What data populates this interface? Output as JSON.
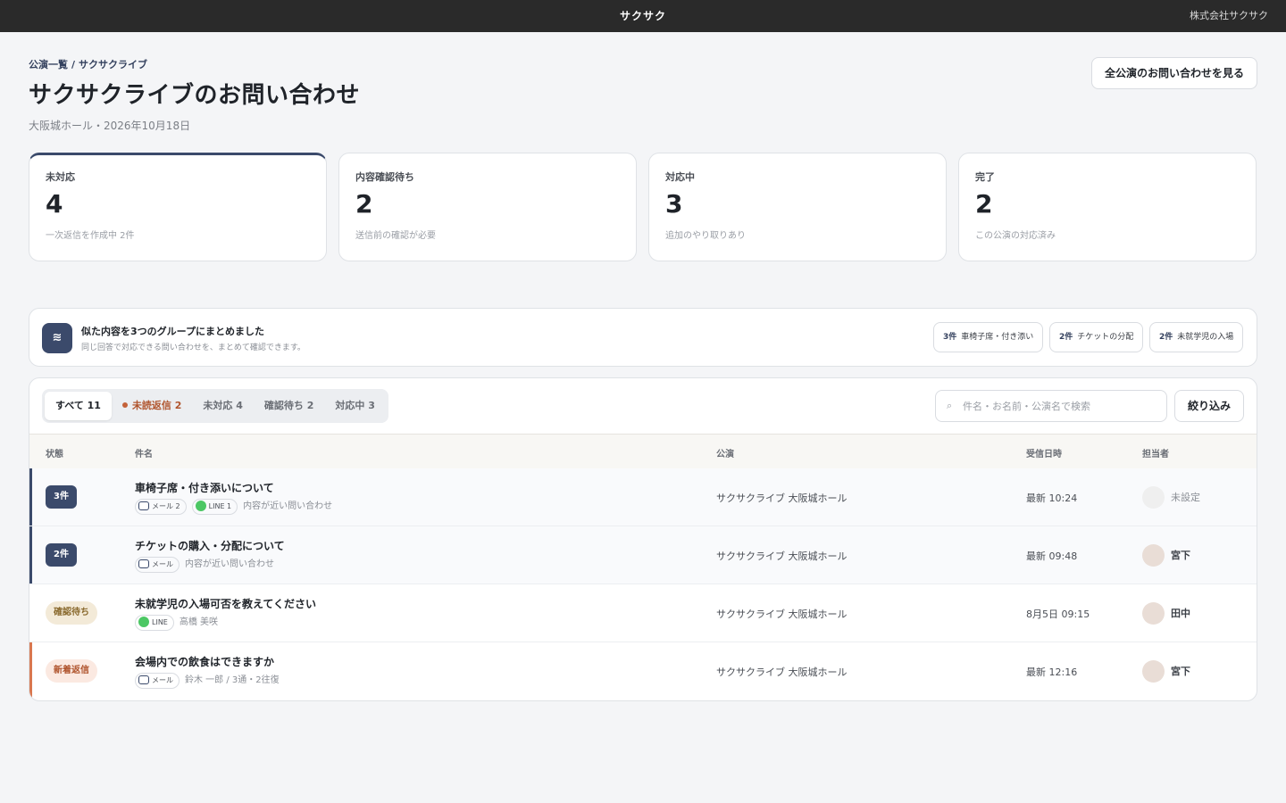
{
  "topbar": {
    "brand": "サクサク",
    "company": "株式会社サクサク"
  },
  "breadcrumb": {
    "root": "公演一覧",
    "sep": "/",
    "current": "サクサクライブ"
  },
  "page": {
    "title": "サクサクライブのお問い合わせ",
    "subtitle": "大阪城ホール・2026年10月18日",
    "all_button": "全公演のお問い合わせを見る"
  },
  "stats": [
    {
      "label": "未対応",
      "value": "4",
      "note": "一次返信を作成中 2件"
    },
    {
      "label": "内容確認待ち",
      "value": "2",
      "note": "送信前の確認が必要"
    },
    {
      "label": "対応中",
      "value": "3",
      "note": "追加のやり取りあり"
    },
    {
      "label": "完了",
      "value": "2",
      "note": "この公演の対応済み"
    }
  ],
  "groups": {
    "icon": "≋",
    "title": "似た内容を3つのグループにまとめました",
    "subtitle": "同じ回答で対応できる問い合わせを、まとめて確認できます。",
    "chips": [
      {
        "count": "3件",
        "label": "車椅子席・付き添い"
      },
      {
        "count": "2件",
        "label": "チケットの分配"
      },
      {
        "count": "2件",
        "label": "未就学児の入場"
      }
    ]
  },
  "tabs": [
    {
      "label": "すべて 11"
    },
    {
      "label": "未読返信 2"
    },
    {
      "label": "未対応 4"
    },
    {
      "label": "確認待ち 2"
    },
    {
      "label": "対応中 3"
    }
  ],
  "search": {
    "icon": "search-icon",
    "placeholder": "件名・お名前・公演名で検索"
  },
  "filter_button": "絞り込み",
  "columns": {
    "status": "状態",
    "subject": "件名",
    "performance": "公演",
    "received": "受信日時",
    "owner": "担当者"
  },
  "colors": {
    "navy": "#3b4a6b",
    "confirm_bg": "#f3ead8",
    "confirm_fg": "#8a6a2e",
    "new_bg": "#fbe9e1",
    "new_fg": "#b0552e",
    "new_accent": "#d9774f",
    "line_green": "#4cc764",
    "avatar": "#e9ddd6",
    "avatar_unset": "#efefef"
  },
  "rows": [
    {
      "status": "3件",
      "subject": "車椅子席・付き添いについて",
      "tags": [
        "メール 2",
        "LINE 1"
      ],
      "meta": "内容が近い問い合わせ",
      "performance": "サクサクライブ 大阪城ホール",
      "received": "最新 10:24",
      "owner": "未設定"
    },
    {
      "status": "2件",
      "subject": "チケットの購入・分配について",
      "tags": [
        "メール"
      ],
      "meta": "内容が近い問い合わせ",
      "performance": "サクサクライブ 大阪城ホール",
      "received": "最新 09:48",
      "owner": "宮下"
    },
    {
      "status": "確認待ち",
      "subject": "未就学児の入場可否を教えてください",
      "tags": [
        "LINE"
      ],
      "meta": "高橋 美咲",
      "performance": "サクサクライブ 大阪城ホール",
      "received": "8月5日 09:15",
      "owner": "田中"
    },
    {
      "status": "新着返信",
      "subject": "会場内での飲食はできますか",
      "tags": [
        "メール"
      ],
      "meta": "鈴木 一郎 / 3通・2往復",
      "performance": "サクサクライブ 大阪城ホール",
      "received": "最新 12:16",
      "owner": "宮下"
    }
  ]
}
